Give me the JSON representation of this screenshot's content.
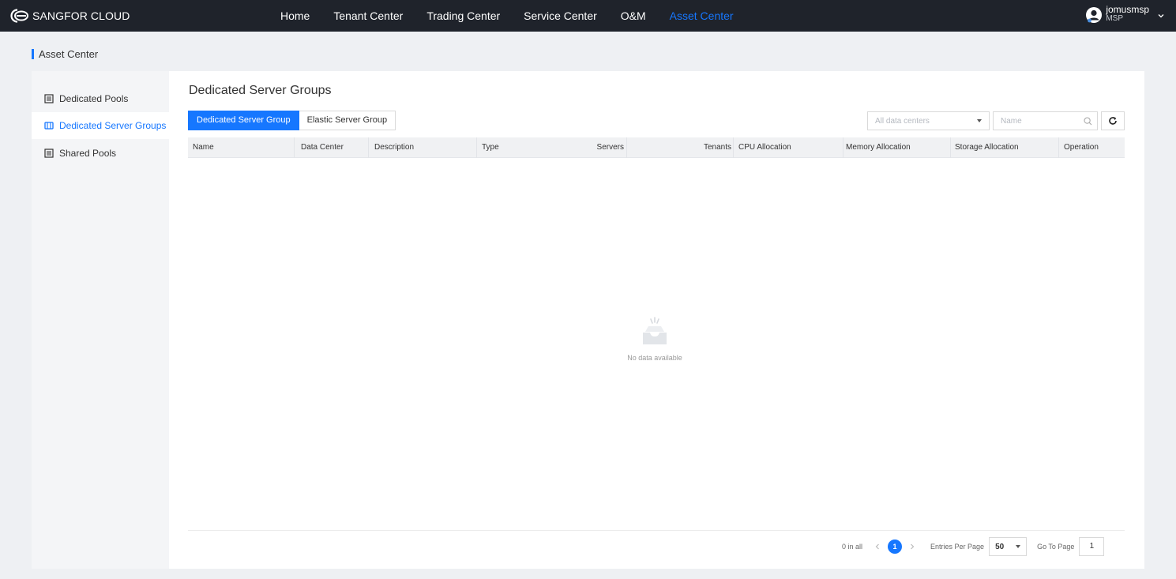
{
  "topbar": {
    "logo_text": "SANGFOR CLOUD",
    "nav": [
      {
        "label": "Home",
        "active": false
      },
      {
        "label": "Tenant Center",
        "active": false
      },
      {
        "label": "Trading Center",
        "active": false
      },
      {
        "label": "Service Center",
        "active": false
      },
      {
        "label": "O&M",
        "active": false
      },
      {
        "label": "Asset Center",
        "active": true
      }
    ],
    "user": {
      "name": "jomusmsp",
      "role": "MSP"
    }
  },
  "breadcrumb": {
    "title": "Asset Center"
  },
  "sidebar": {
    "items": [
      {
        "label": "Dedicated Pools",
        "icon": "list-icon",
        "active": false
      },
      {
        "label": "Dedicated Server Groups",
        "icon": "server-group-icon",
        "active": true
      },
      {
        "label": "Shared Pools",
        "icon": "list-icon",
        "active": false
      }
    ]
  },
  "main": {
    "title": "Dedicated Server Groups",
    "tabs": [
      {
        "label": "Dedicated Server Group",
        "active": true
      },
      {
        "label": "Elastic Server Group",
        "active": false
      }
    ],
    "filters": {
      "datacenter_placeholder": "All data centers",
      "name_placeholder": "Name"
    },
    "table": {
      "columns": [
        "Name",
        "Data Center",
        "Description",
        "Type",
        "Servers",
        "Tenants",
        "CPU Allocation",
        "Memory Allocation",
        "Storage Allocation",
        "Operation"
      ],
      "rows": [],
      "empty_text": "No data available"
    },
    "pagination": {
      "total_text": "0 in all",
      "current_page": "1",
      "per_page_label": "Entries Per Page",
      "per_page_value": "50",
      "goto_label": "Go To Page",
      "goto_value": "1"
    }
  },
  "colors": {
    "accent": "#1677ff",
    "topbar_bg": "#1f232b",
    "page_bg": "#eef0f3"
  }
}
